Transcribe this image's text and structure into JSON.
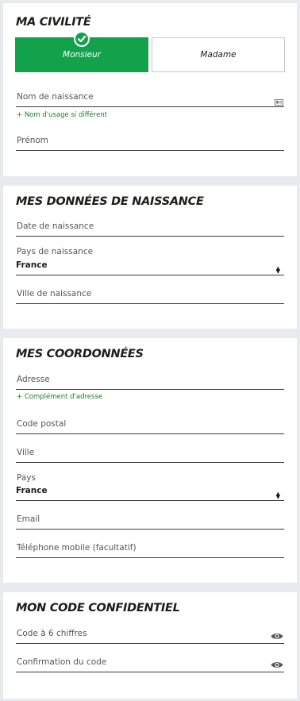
{
  "civility": {
    "title": "MA CIVILITÉ",
    "option_monsieur": "Monsieur",
    "option_madame": "Madame",
    "birth_name_label": "Nom de naissance",
    "usage_name_link": "+ Nom d'usage si différent",
    "first_name_label": "Prénom"
  },
  "birth": {
    "title": "MES DONNÉES DE NAISSANCE",
    "birth_date_label": "Date de naissance",
    "birth_country_label": "Pays de naissance",
    "birth_country_value": "France",
    "birth_city_label": "Ville de naissance"
  },
  "contact": {
    "title": "MES COORDONNÉES",
    "address_label": "Adresse",
    "address_complement_link": "+ Complément d'adresse",
    "postal_code_label": "Code postal",
    "city_label": "Ville",
    "country_label": "Pays",
    "country_value": "France",
    "email_label": "Email",
    "mobile_label": "Téléphone mobile (facultatif)"
  },
  "code": {
    "title": "MON CODE CONFIDENTIEL",
    "code_label": "Code à 6 chiffres",
    "confirm_label": "Confirmation du code"
  },
  "colors": {
    "accent": "#13a24c",
    "link": "#1e7a32",
    "page_background": "#e8ebee"
  },
  "icons": {
    "selected": "check-icon",
    "id_card": "id-card-icon",
    "select": "select-arrows-icon",
    "reveal": "eye-icon"
  }
}
